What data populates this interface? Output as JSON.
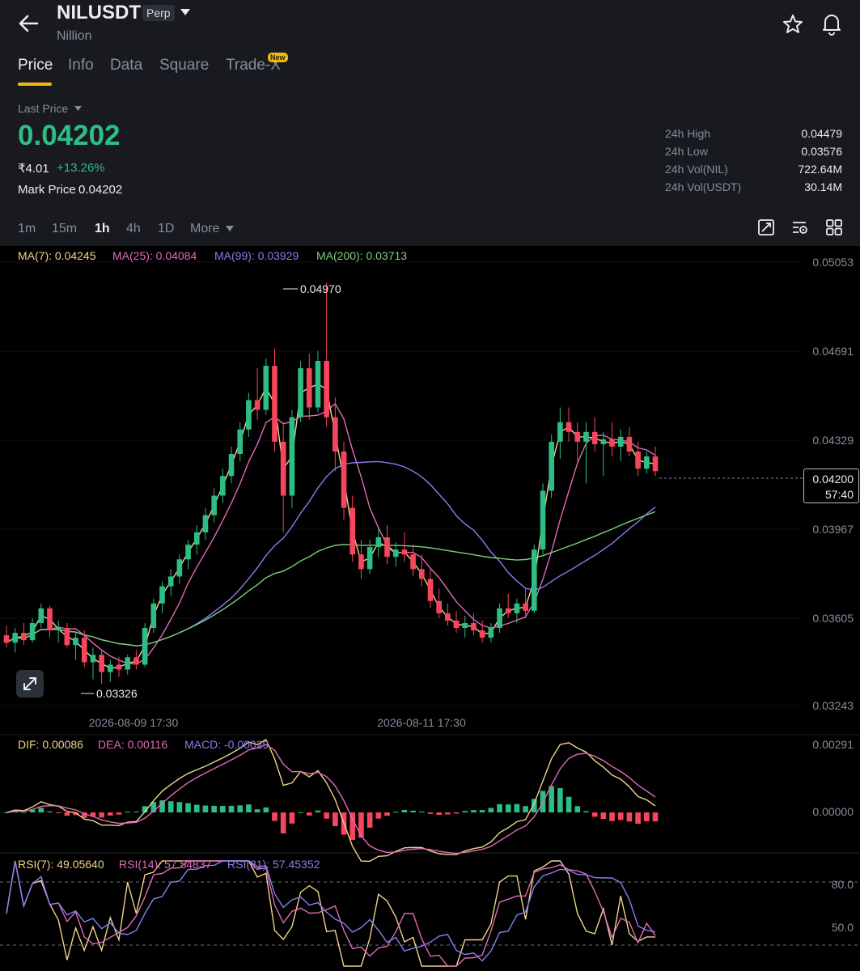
{
  "header": {
    "symbol": "NILUSDT",
    "contract_type": "Perp",
    "name": "Nillion",
    "new_badge": "New"
  },
  "tabs": [
    {
      "label": "Price",
      "active": true
    },
    {
      "label": "Info"
    },
    {
      "label": "Data"
    },
    {
      "label": "Square"
    },
    {
      "label": "Trade-X"
    }
  ],
  "price": {
    "last_label": "Last Price",
    "last_value": "0.04202",
    "fiat_value": "₹4.01",
    "change_pct": "+13.26%",
    "mark_label": "Mark Price",
    "mark_value": "0.04202"
  },
  "stats": [
    {
      "label": "24h High",
      "value": "0.04479"
    },
    {
      "label": "24h Low",
      "value": "0.03576"
    },
    {
      "label": "24h Vol(NIL)",
      "value": "722.64M"
    },
    {
      "label": "24h Vol(USDT)",
      "value": "30.14M"
    }
  ],
  "intervals": [
    "1m",
    "15m",
    "1h",
    "4h",
    "1D",
    "More"
  ],
  "active_interval": "1h",
  "icons": {
    "tools": [
      "depth-chart-icon",
      "chart-settings-icon",
      "layout-grid-icon"
    ],
    "header": [
      "back-arrow-icon",
      "favorite-star-icon",
      "price-alert-bell-icon"
    ],
    "chart": [
      "expand-icon"
    ]
  },
  "colors": {
    "up": "#2ebd85",
    "down": "#f6465d",
    "accent": "#f0b90b",
    "ma7": "#f0d48a",
    "ma25": "#e06bb6",
    "ma99": "#8a7cf0",
    "ma200": "#7ad17a"
  },
  "ma_legend": {
    "ma7": "MA(7): 0.04245",
    "ma25": "MA(25): 0.04084",
    "ma99": "MA(99): 0.03929",
    "ma200": "MA(200): 0.03713"
  },
  "macd_legend": {
    "dif": "DIF: 0.00086",
    "dea": "DEA: 0.00116",
    "macd": "MACD: -0.00029"
  },
  "rsi_legend": {
    "rsi7": "RSI(7): 49.05640",
    "rsi14": "RSI(14): 57.54837",
    "rsi21": "RSI(21): 57.45352"
  },
  "last_tag": {
    "price": "0.04200",
    "countdown": "57:40"
  },
  "chart_data": {
    "type": "candlestick",
    "interval": "1h",
    "price_axis_labels": [
      "0.05053",
      "0.04691",
      "0.04329",
      "0.03967",
      "0.03605",
      "0.03243"
    ],
    "time_axis_labels": [
      "2026-08-09 17:30",
      "2026-08-11 17:30"
    ],
    "ylim": [
      0.0324,
      0.0506
    ],
    "high_marker": "0.04970",
    "low_marker": "0.03326",
    "last_price": 0.042,
    "ohlc_approx": [
      [
        0.0353,
        0.0357,
        0.0348,
        0.035
      ],
      [
        0.035,
        0.0356,
        0.0346,
        0.0354
      ],
      [
        0.0354,
        0.0358,
        0.0349,
        0.0351
      ],
      [
        0.0351,
        0.036,
        0.035,
        0.0358
      ],
      [
        0.0358,
        0.0366,
        0.0356,
        0.0364
      ],
      [
        0.0364,
        0.0365,
        0.0352,
        0.0355
      ],
      [
        0.0355,
        0.0359,
        0.035,
        0.0356
      ],
      [
        0.0356,
        0.0358,
        0.0348,
        0.0349
      ],
      [
        0.0349,
        0.0354,
        0.0343,
        0.0352
      ],
      [
        0.0352,
        0.0355,
        0.034,
        0.0342
      ],
      [
        0.0342,
        0.0348,
        0.0335,
        0.0345
      ],
      [
        0.0345,
        0.0347,
        0.0333,
        0.0338
      ],
      [
        0.0338,
        0.0343,
        0.0334,
        0.0341
      ],
      [
        0.0341,
        0.0344,
        0.0336,
        0.0339
      ],
      [
        0.0339,
        0.0345,
        0.0337,
        0.0344
      ],
      [
        0.0344,
        0.0347,
        0.0339,
        0.0341
      ],
      [
        0.0341,
        0.0358,
        0.034,
        0.0356
      ],
      [
        0.0356,
        0.0368,
        0.0354,
        0.0366
      ],
      [
        0.0366,
        0.0375,
        0.0362,
        0.0373
      ],
      [
        0.0373,
        0.038,
        0.0369,
        0.0377
      ],
      [
        0.0377,
        0.0386,
        0.0374,
        0.0384
      ],
      [
        0.0384,
        0.0392,
        0.038,
        0.039
      ],
      [
        0.039,
        0.0398,
        0.0386,
        0.0395
      ],
      [
        0.0395,
        0.0405,
        0.0392,
        0.0402
      ],
      [
        0.0402,
        0.0413,
        0.0399,
        0.041
      ],
      [
        0.041,
        0.0421,
        0.0407,
        0.0418
      ],
      [
        0.0418,
        0.043,
        0.0415,
        0.0427
      ],
      [
        0.0427,
        0.044,
        0.0424,
        0.0437
      ],
      [
        0.0437,
        0.0452,
        0.0434,
        0.0449
      ],
      [
        0.0449,
        0.0462,
        0.0441,
        0.0445
      ],
      [
        0.0445,
        0.0466,
        0.0443,
        0.0463
      ],
      [
        0.0463,
        0.047,
        0.0428,
        0.0432
      ],
      [
        0.0432,
        0.044,
        0.0395,
        0.041
      ],
      [
        0.041,
        0.0445,
        0.0405,
        0.0442
      ],
      [
        0.0442,
        0.0465,
        0.044,
        0.0462
      ],
      [
        0.0462,
        0.0468,
        0.0441,
        0.0446
      ],
      [
        0.0446,
        0.0469,
        0.0444,
        0.0465
      ],
      [
        0.0465,
        0.0497,
        0.0438,
        0.0442
      ],
      [
        0.0442,
        0.045,
        0.042,
        0.0428
      ],
      [
        0.0428,
        0.0432,
        0.04,
        0.0405
      ],
      [
        0.0405,
        0.041,
        0.0383,
        0.0386
      ],
      [
        0.0386,
        0.0392,
        0.0376,
        0.038
      ],
      [
        0.038,
        0.0392,
        0.0378,
        0.0389
      ],
      [
        0.0389,
        0.0397,
        0.0385,
        0.0393
      ],
      [
        0.0393,
        0.0398,
        0.0382,
        0.0385
      ],
      [
        0.0385,
        0.0391,
        0.0381,
        0.0388
      ],
      [
        0.0388,
        0.0395,
        0.0383,
        0.0386
      ],
      [
        0.0386,
        0.039,
        0.0377,
        0.038
      ],
      [
        0.038,
        0.0386,
        0.0373,
        0.0376
      ],
      [
        0.0376,
        0.038,
        0.0364,
        0.0367
      ],
      [
        0.0367,
        0.0372,
        0.036,
        0.0362
      ],
      [
        0.0362,
        0.0366,
        0.0357,
        0.0359
      ],
      [
        0.0359,
        0.0363,
        0.0354,
        0.0356
      ],
      [
        0.0356,
        0.0361,
        0.0352,
        0.0358
      ],
      [
        0.0358,
        0.0362,
        0.0353,
        0.0355
      ],
      [
        0.0355,
        0.0359,
        0.035,
        0.0352
      ],
      [
        0.0352,
        0.0358,
        0.035,
        0.0356
      ],
      [
        0.0356,
        0.0366,
        0.0354,
        0.0364
      ],
      [
        0.0364,
        0.037,
        0.036,
        0.0362
      ],
      [
        0.0362,
        0.0368,
        0.0358,
        0.0366
      ],
      [
        0.0366,
        0.0372,
        0.036,
        0.0363
      ],
      [
        0.0363,
        0.039,
        0.0362,
        0.0388
      ],
      [
        0.0388,
        0.0415,
        0.0386,
        0.0412
      ],
      [
        0.0412,
        0.0435,
        0.0409,
        0.0432
      ],
      [
        0.0432,
        0.0446,
        0.0425,
        0.044
      ],
      [
        0.044,
        0.0446,
        0.0432,
        0.0436
      ],
      [
        0.0436,
        0.044,
        0.0424,
        0.0432
      ],
      [
        0.0432,
        0.044,
        0.0415,
        0.0436
      ],
      [
        0.0436,
        0.0442,
        0.0428,
        0.0431
      ],
      [
        0.0431,
        0.0436,
        0.0418,
        0.0433
      ],
      [
        0.0433,
        0.044,
        0.0426,
        0.043
      ],
      [
        0.043,
        0.0437,
        0.0424,
        0.0434
      ],
      [
        0.0434,
        0.0438,
        0.0426,
        0.0428
      ],
      [
        0.0428,
        0.0432,
        0.0418,
        0.0421
      ],
      [
        0.0421,
        0.0428,
        0.0419,
        0.0426
      ],
      [
        0.0426,
        0.043,
        0.0418,
        0.042
      ]
    ],
    "ma_series": [
      "MA(7)",
      "MA(25)",
      "MA(99)",
      "MA(200)"
    ],
    "macd": {
      "axis_labels": [
        "0.00291",
        "0.00000"
      ]
    },
    "rsi": {
      "axis_labels": [
        "80.0",
        "50.0"
      ]
    }
  }
}
